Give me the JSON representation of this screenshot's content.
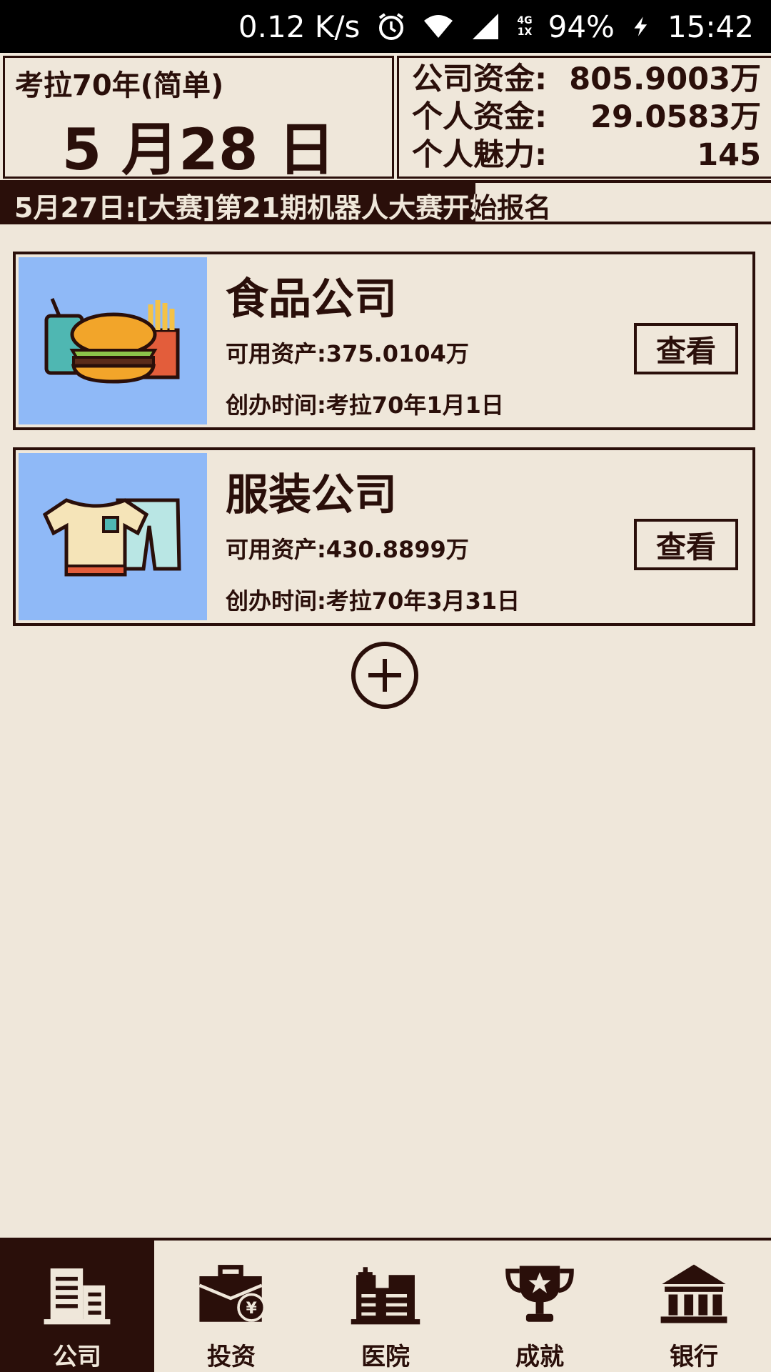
{
  "status_bar": {
    "speed": "0.12 K/s",
    "network": "4G",
    "sim": "1X",
    "battery": "94%",
    "time": "15:42"
  },
  "header": {
    "game_label": "考拉70年(简单)",
    "date": "5 月28 日",
    "stats": [
      {
        "label": "公司资金:",
        "value": "805.9003万"
      },
      {
        "label": "个人资金:",
        "value": "29.0583万"
      },
      {
        "label": "个人魅力:",
        "value": "145"
      }
    ]
  },
  "ticker": {
    "text": "5月27日:[大赛]第21期机器人大赛开始报名"
  },
  "companies": [
    {
      "name": "食品公司",
      "assets": "可用资产:375.0104万",
      "founded": "创办时间:考拉70年1月1日",
      "button": "查看",
      "icon": "burger-fries-icon"
    },
    {
      "name": "服装公司",
      "assets": "可用资产:430.8899万",
      "founded": "创办时间:考拉70年3月31日",
      "button": "查看",
      "icon": "shirt-pants-icon"
    }
  ],
  "nav": [
    {
      "label": "公司",
      "icon": "building-icon",
      "active": true
    },
    {
      "label": "投资",
      "icon": "briefcase-yen-icon",
      "active": false
    },
    {
      "label": "医院",
      "icon": "hospital-icon",
      "active": false
    },
    {
      "label": "成就",
      "icon": "trophy-icon",
      "active": false
    },
    {
      "label": "银行",
      "icon": "bank-icon",
      "active": false
    }
  ]
}
